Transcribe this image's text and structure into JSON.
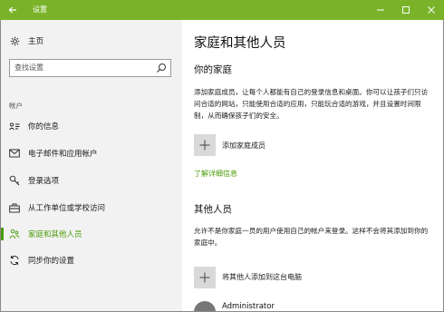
{
  "window": {
    "title": "设置",
    "accent_color": "#7ab329"
  },
  "sidebar": {
    "home_label": "主页",
    "search_placeholder": "查找设置",
    "section_caption": "帐户",
    "items": [
      {
        "label": "你的信息",
        "icon": "person-card-icon"
      },
      {
        "label": "电子邮件和应用帐户",
        "icon": "mail-icon"
      },
      {
        "label": "登录选项",
        "icon": "key-icon"
      },
      {
        "label": "从工作单位或学校访问",
        "icon": "briefcase-icon"
      },
      {
        "label": "家庭和其他人员",
        "icon": "people-icon",
        "active": true
      },
      {
        "label": "同步你的设置",
        "icon": "sync-icon"
      }
    ]
  },
  "main": {
    "page_title": "家庭和其他人员",
    "family": {
      "heading": "你的家庭",
      "description": "添加家庭成员，让每个人都能有自己的登录信息和桌面。你可以让孩子们只访问合适的网站，只能使用合适的应用，只能玩合适的游戏，并且设置时间限制，从而确保孩子们的安全。",
      "add_label": "添加家庭成员",
      "learn_more": "了解详细信息"
    },
    "others": {
      "heading": "其他人员",
      "description": "允许不是你家庭一员的用户使用自己的帐户来登录。这样不会将其添加到你的家庭中。",
      "add_label": "将其他人添加到这台电脑",
      "user_name": "Administrator"
    }
  }
}
